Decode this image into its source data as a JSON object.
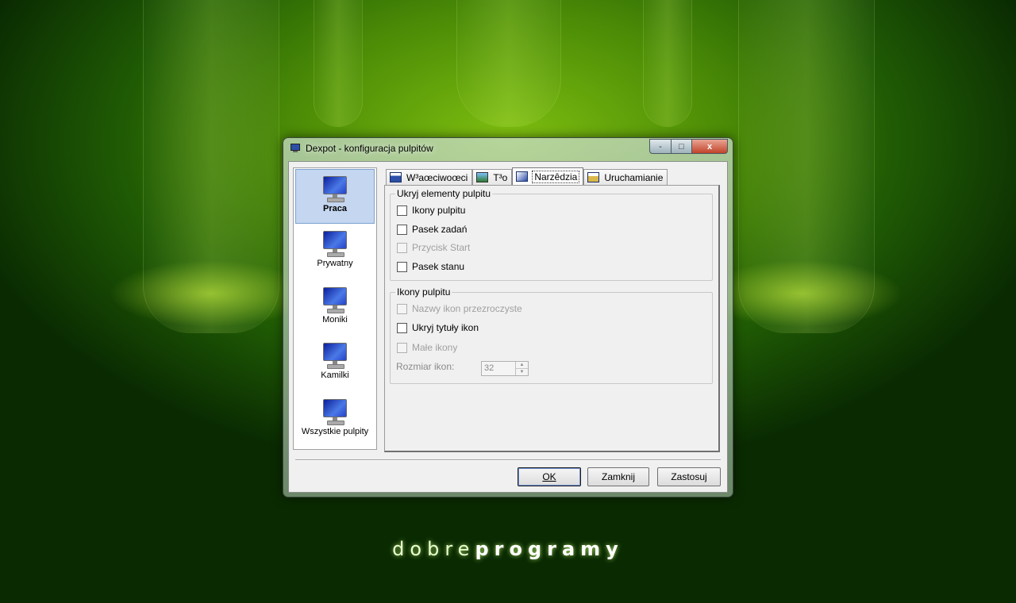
{
  "window": {
    "title": "Dexpot - konfiguracja pulpitów",
    "controls": {
      "minimize": "-",
      "maximize": "□",
      "close": "x"
    }
  },
  "sidebar": {
    "items": [
      {
        "label": "Praca",
        "selected": true
      },
      {
        "label": "Prywatny",
        "selected": false
      },
      {
        "label": "Moniki",
        "selected": false
      },
      {
        "label": "Kamilki",
        "selected": false
      },
      {
        "label": "Wszystkie pulpity",
        "selected": false
      }
    ]
  },
  "tabs": [
    {
      "label": "W³aœciwoœci",
      "icon": "properties-icon"
    },
    {
      "label": "T³o",
      "icon": "image-icon"
    },
    {
      "label": "Narzêdzia",
      "icon": "tools-icon",
      "active": true
    },
    {
      "label": "Uruchamianie",
      "icon": "run-icon"
    }
  ],
  "groups": {
    "hide_elements": {
      "title": "Ukryj elementy pulpitu",
      "options": [
        {
          "label": "Ikony pulpitu",
          "checked": false,
          "enabled": true
        },
        {
          "label": "Pasek zadań",
          "checked": false,
          "enabled": true
        },
        {
          "label": "Przycisk Start",
          "checked": false,
          "enabled": false
        },
        {
          "label": "Pasek stanu",
          "checked": false,
          "enabled": true
        }
      ]
    },
    "desktop_icons": {
      "title": "Ikony pulpitu",
      "options": [
        {
          "label": "Nazwy ikon przezroczyste",
          "checked": false,
          "enabled": false
        },
        {
          "label": "Ukryj tytuły ikon",
          "checked": false,
          "enabled": true
        },
        {
          "label": "Małe ikony",
          "checked": false,
          "enabled": false
        }
      ],
      "size_label": "Rozmiar ikon:",
      "size_value": "32"
    }
  },
  "buttons": {
    "ok": "OK",
    "close": "Zamknij",
    "apply": "Zastosuj"
  },
  "background": {
    "brand_light": "dobre",
    "brand_bold": "programy"
  },
  "colors": {
    "accent": "#c4d6f0",
    "background": "#4a8a06"
  }
}
